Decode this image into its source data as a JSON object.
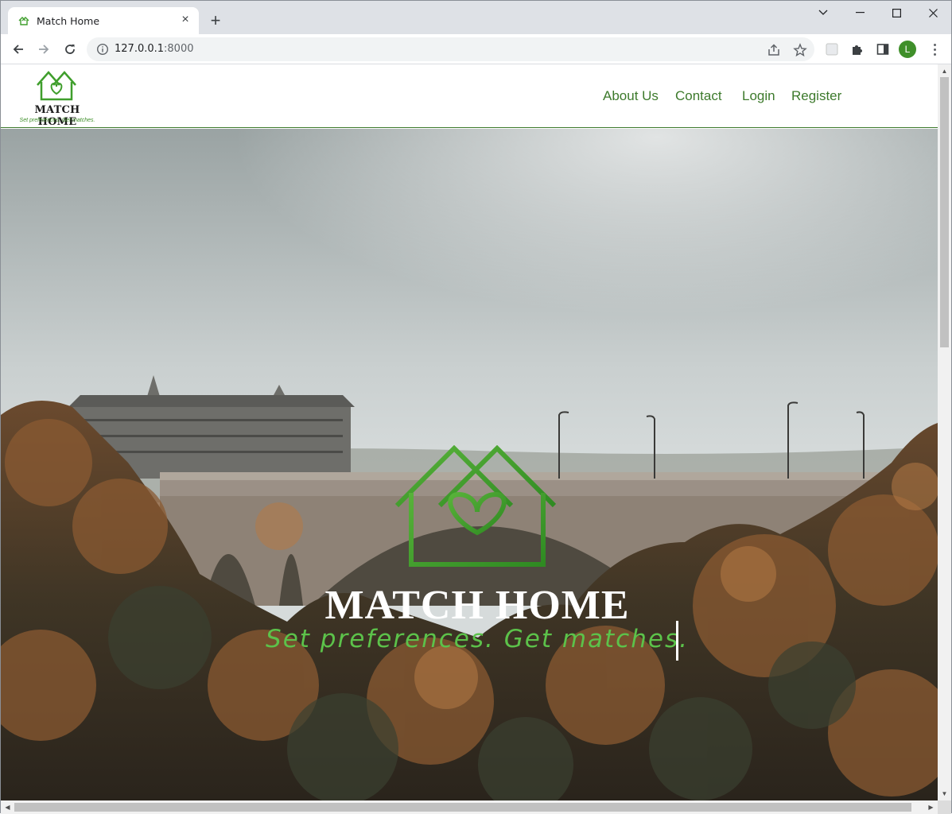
{
  "browser": {
    "tab_title": "Match Home",
    "tab_close": "×",
    "new_tab": "+",
    "url_host": "127.0.0.1",
    "url_port": ":8000",
    "profile_initial": "L"
  },
  "header": {
    "brand_name": "MATCH HOME",
    "brand_tagline": "Set preferences. Get matches.",
    "nav": [
      "About Us",
      "Contact",
      "Login",
      "Register"
    ]
  },
  "hero": {
    "title": "MATCH HOME",
    "tagline": "Set preferences. Get matches."
  },
  "colors": {
    "brand_green": "#3d7a2c",
    "accent_green": "#5cc24a",
    "logo_green": "#3f9e2c"
  }
}
